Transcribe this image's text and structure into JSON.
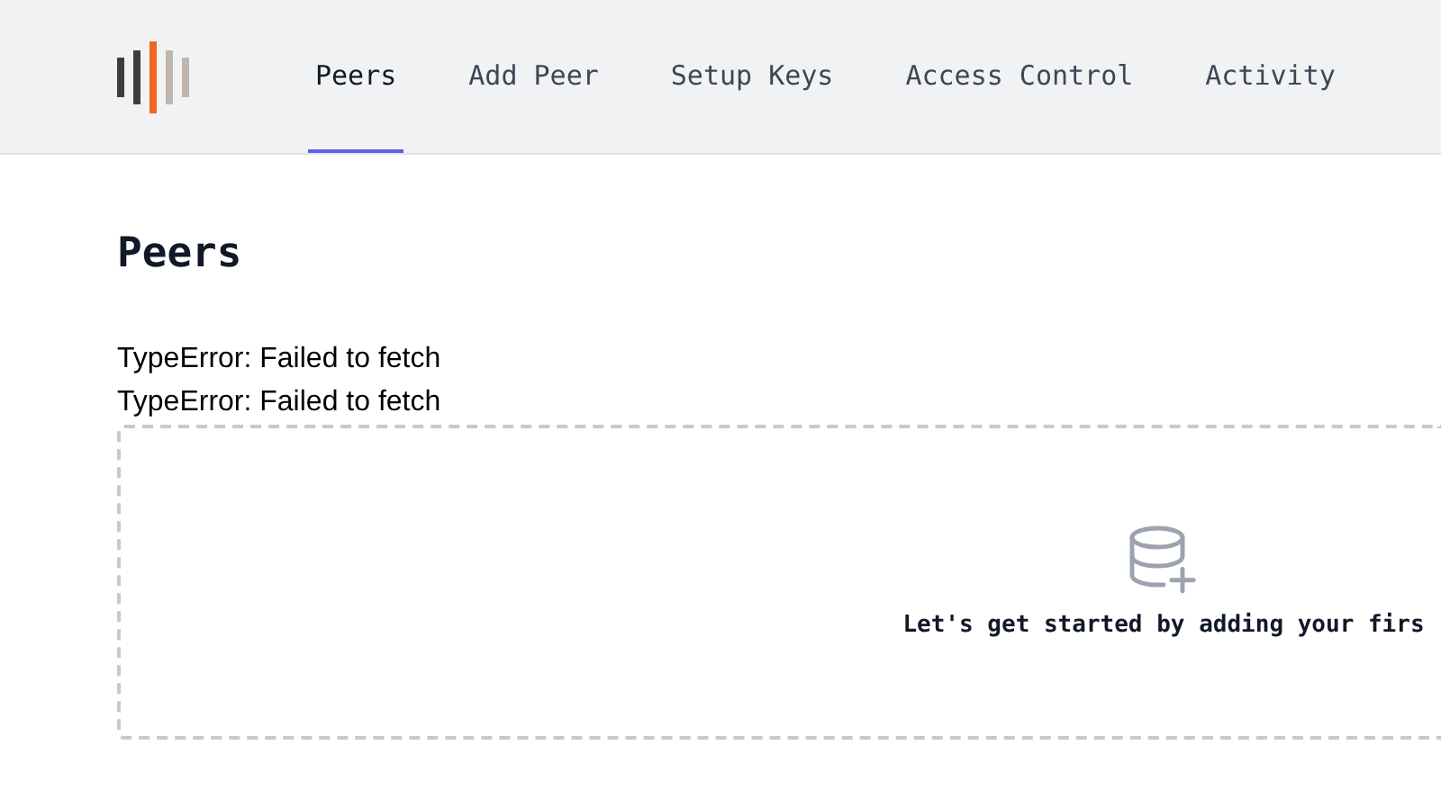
{
  "nav": {
    "tabs": [
      {
        "label": "Peers",
        "selected": true
      },
      {
        "label": "Add Peer",
        "selected": false
      },
      {
        "label": "Setup Keys",
        "selected": false
      },
      {
        "label": "Access Control",
        "selected": false
      },
      {
        "label": "Activity",
        "selected": false
      }
    ]
  },
  "page": {
    "title": "Peers",
    "errors": [
      "TypeError: Failed to fetch",
      "TypeError: Failed to fetch"
    ],
    "empty_state": {
      "message": "Let's get started by adding your firs"
    }
  }
}
